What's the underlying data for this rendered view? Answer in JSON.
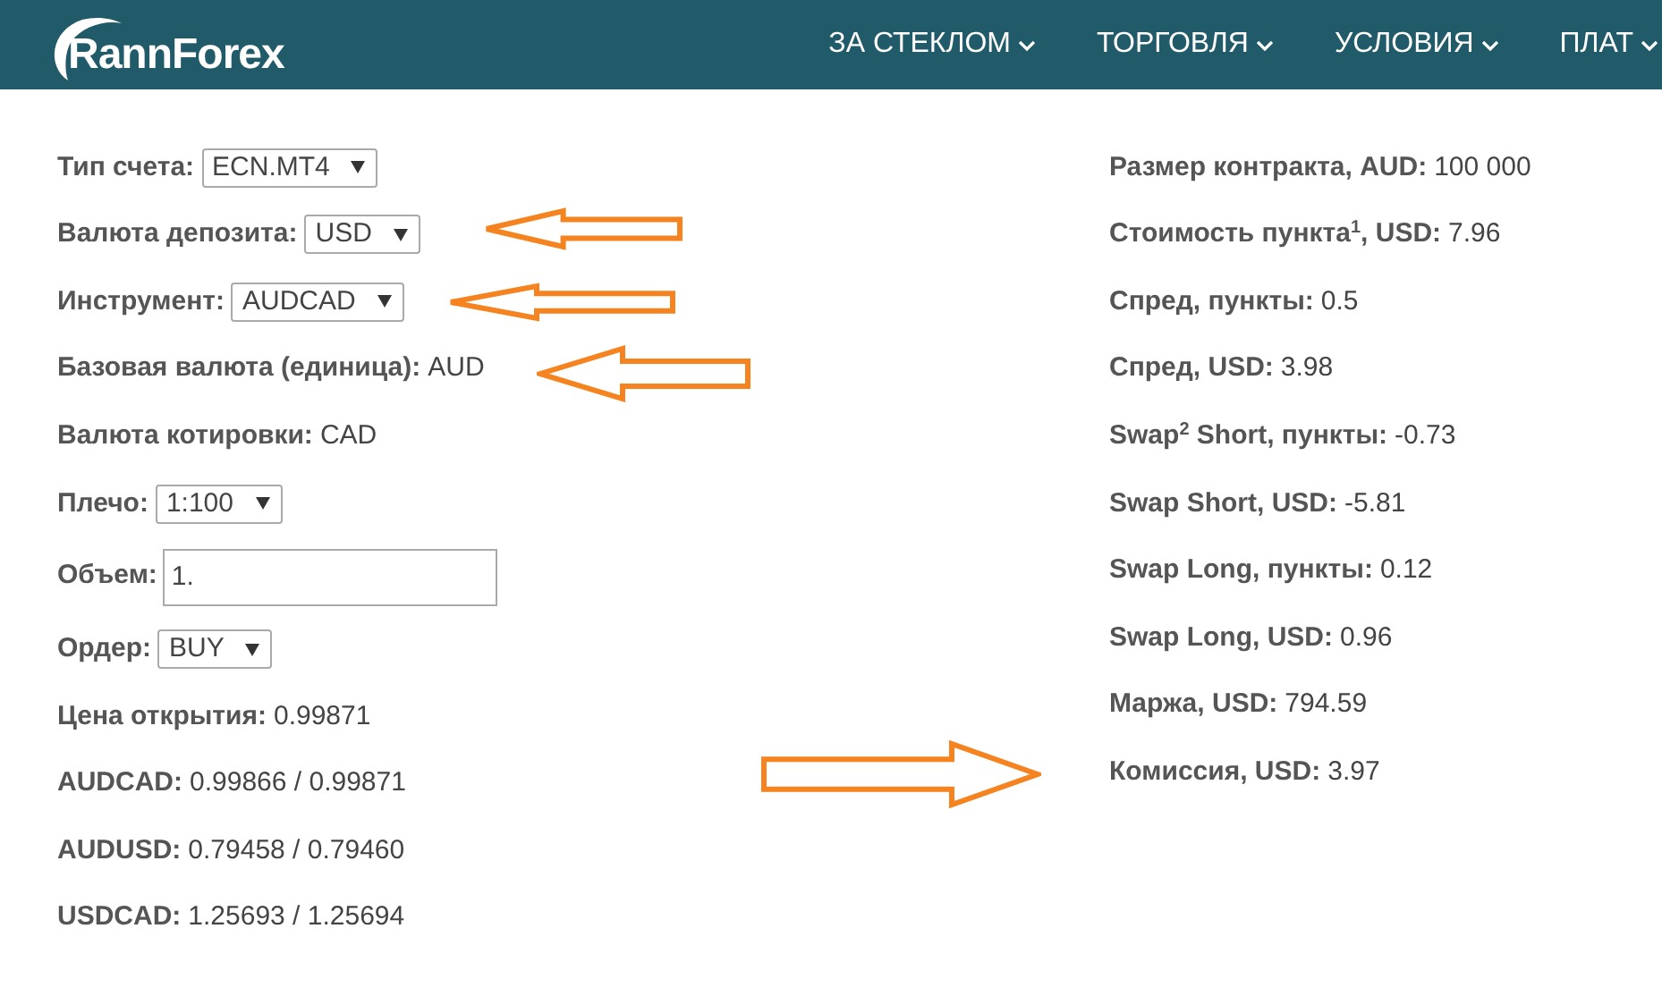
{
  "header": {
    "logo": "RannForex",
    "nav": [
      {
        "label": "ЗА СТЕКЛОМ"
      },
      {
        "label": "ТОРГОВЛЯ"
      },
      {
        "label": "УСЛОВИЯ"
      },
      {
        "label": "ПЛАТ"
      }
    ]
  },
  "left": [
    {
      "kind": "select",
      "label": "Тип счета:",
      "value": "ECN.MT4"
    },
    {
      "kind": "select",
      "label": "Валюта депозита:",
      "value": "USD"
    },
    {
      "kind": "select",
      "label": "Инструмент:",
      "value": "AUDCAD"
    },
    {
      "kind": "text",
      "label": "Базовая валюта (единица):",
      "value": "AUD"
    },
    {
      "kind": "text",
      "label": "Валюта котировки:",
      "value": "CAD"
    },
    {
      "kind": "select",
      "label": "Плечо:",
      "value": "1:100"
    },
    {
      "kind": "input",
      "label": "Объем:",
      "value": "1."
    },
    {
      "kind": "select",
      "label": "Ордер:",
      "value": "BUY"
    },
    {
      "kind": "text",
      "label": "Цена открытия:",
      "value": "0.99871"
    },
    {
      "kind": "text",
      "label": "AUDCAD:",
      "value": "0.99866 / 0.99871"
    },
    {
      "kind": "text",
      "label": "AUDUSD:",
      "value": "0.79458 / 0.79460"
    },
    {
      "kind": "text",
      "label": "USDCAD:",
      "value": "1.25693 / 1.25694"
    }
  ],
  "right": [
    {
      "label": "Размер контракта, AUD:",
      "value": "100 000"
    },
    {
      "label": "Стоимость пункта$^{1}$, USD:",
      "value": "7.96"
    },
    {
      "label": "Спред, пункты:",
      "value": "0.5"
    },
    {
      "label": "Спред, USD:",
      "value": "3.98"
    },
    {
      "label": "Swap$^{2}$ Short, пункты:",
      "value": "-0.73"
    },
    {
      "label": "Swap Short, USD:",
      "value": "-5.81"
    },
    {
      "label": "Swap Long, пункты:",
      "value": "0.12"
    },
    {
      "label": "Swap Long, USD:",
      "value": "0.96"
    },
    {
      "label": "Маржа, USD:",
      "value": "794.59"
    },
    {
      "label": "Комиссия, USD:",
      "value": "3.97"
    }
  ]
}
